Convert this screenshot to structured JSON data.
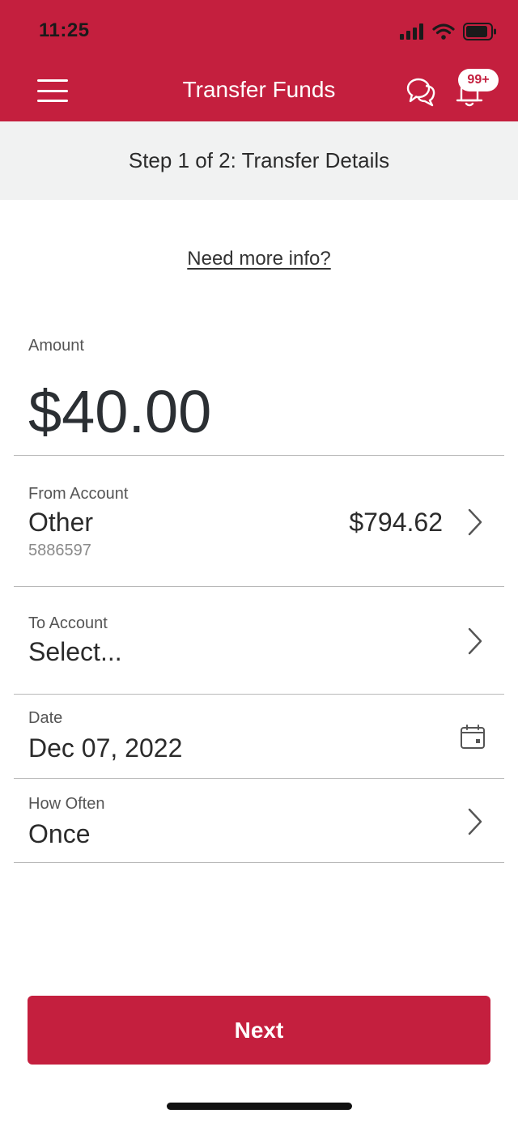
{
  "status_bar": {
    "time": "11:25"
  },
  "header": {
    "title": "Transfer Funds",
    "notification_badge": "99+",
    "brand_color": "#c41f3e"
  },
  "step": {
    "text": "Step 1 of 2: Transfer Details"
  },
  "info_link": {
    "label": "Need more info?"
  },
  "amount": {
    "label": "Amount",
    "value": "$40.00"
  },
  "from_account": {
    "label": "From Account",
    "name": "Other",
    "number": "5886597",
    "balance": "$794.62"
  },
  "to_account": {
    "label": "To Account",
    "value": "Select..."
  },
  "date": {
    "label": "Date",
    "value": "Dec 07, 2022"
  },
  "how_often": {
    "label": "How Often",
    "value": "Once"
  },
  "next_button": {
    "label": "Next"
  }
}
